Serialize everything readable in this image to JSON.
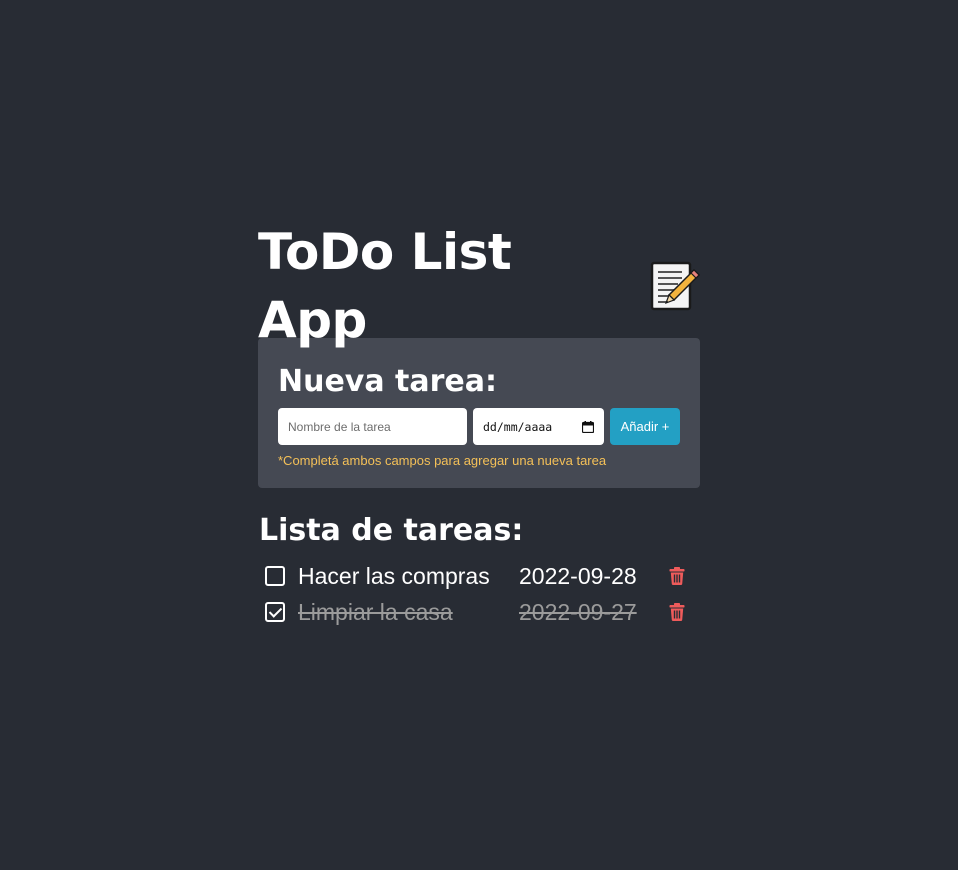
{
  "app": {
    "title": "ToDo List App",
    "title_icon": "memo-icon"
  },
  "new_task": {
    "heading": "Nueva tarea:",
    "name_placeholder": "Nombre de la tarea",
    "date_placeholder": "dd/mm/aaaa",
    "add_label": "Añadir +",
    "hint": "*Completá ambos campos para agregar una nueva tarea"
  },
  "task_list": {
    "heading": "Lista de tareas:",
    "items": [
      {
        "name": "Hacer las compras",
        "date": "2022-09-28",
        "done": false
      },
      {
        "name": "Limpiar la casa",
        "date": "2022-09-27",
        "done": true
      }
    ]
  },
  "colors": {
    "background": "#282c34",
    "card": "#454953",
    "accent_button": "#23a0c4",
    "hint_text": "#f4c058",
    "delete_icon": "#ef5b5b",
    "done_text": "#9b9b9b"
  }
}
